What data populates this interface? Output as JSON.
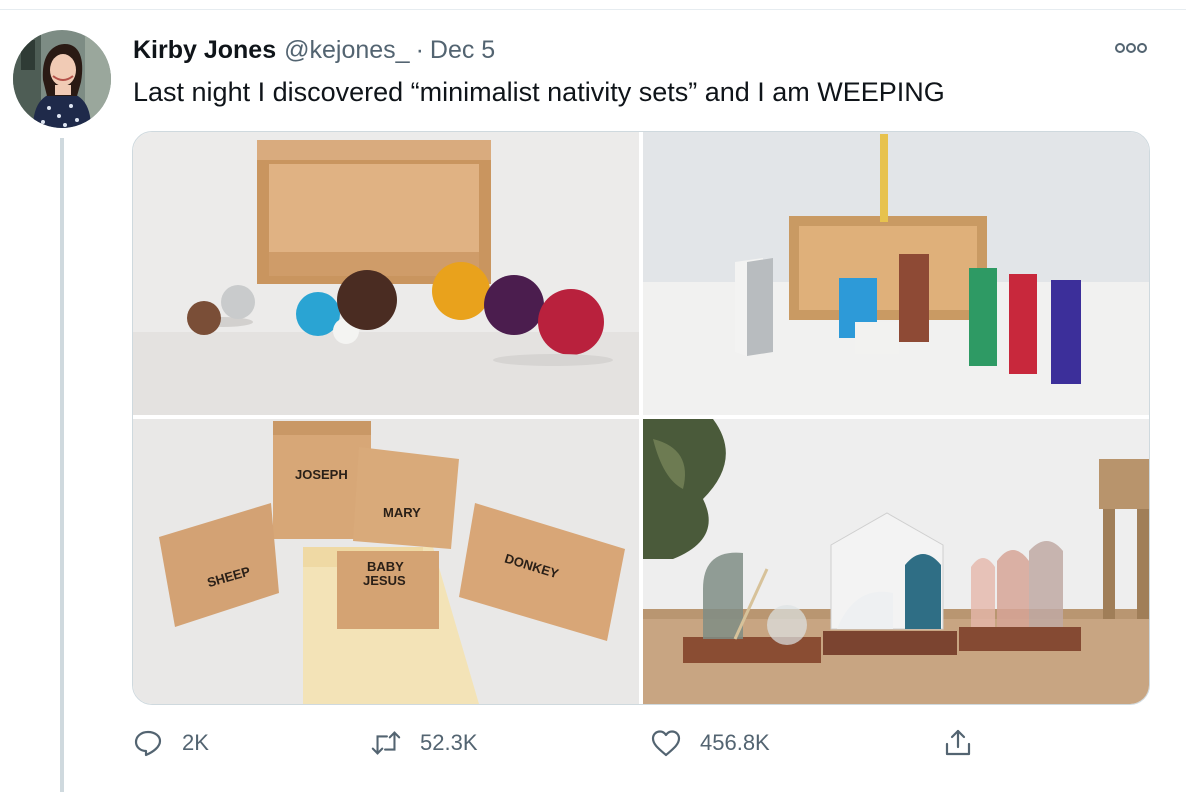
{
  "tweet": {
    "author_name": "Kirby Jones",
    "handle": "@kejones_",
    "separator": "·",
    "date": "Dec 5",
    "text": "Last night I discovered “minimalist nativity sets” and I am WEEPING"
  },
  "media": {
    "block_labels": {
      "joseph": "JOSEPH",
      "mary": "MARY",
      "sheep": "SHEEP",
      "baby_jesus_line1": "BABY",
      "baby_jesus_line2": "JESUS",
      "donkey": "DONKEY"
    }
  },
  "actions": {
    "replies": "2K",
    "retweets": "52.3K",
    "likes": "456.8K"
  },
  "icons": {
    "more": "more-horizontal-icon",
    "reply": "reply-icon",
    "retweet": "retweet-icon",
    "like": "heart-icon",
    "share": "share-icon"
  },
  "colors": {
    "text_primary": "#0f1419",
    "text_secondary": "#536471",
    "border": "#cfd9de"
  }
}
